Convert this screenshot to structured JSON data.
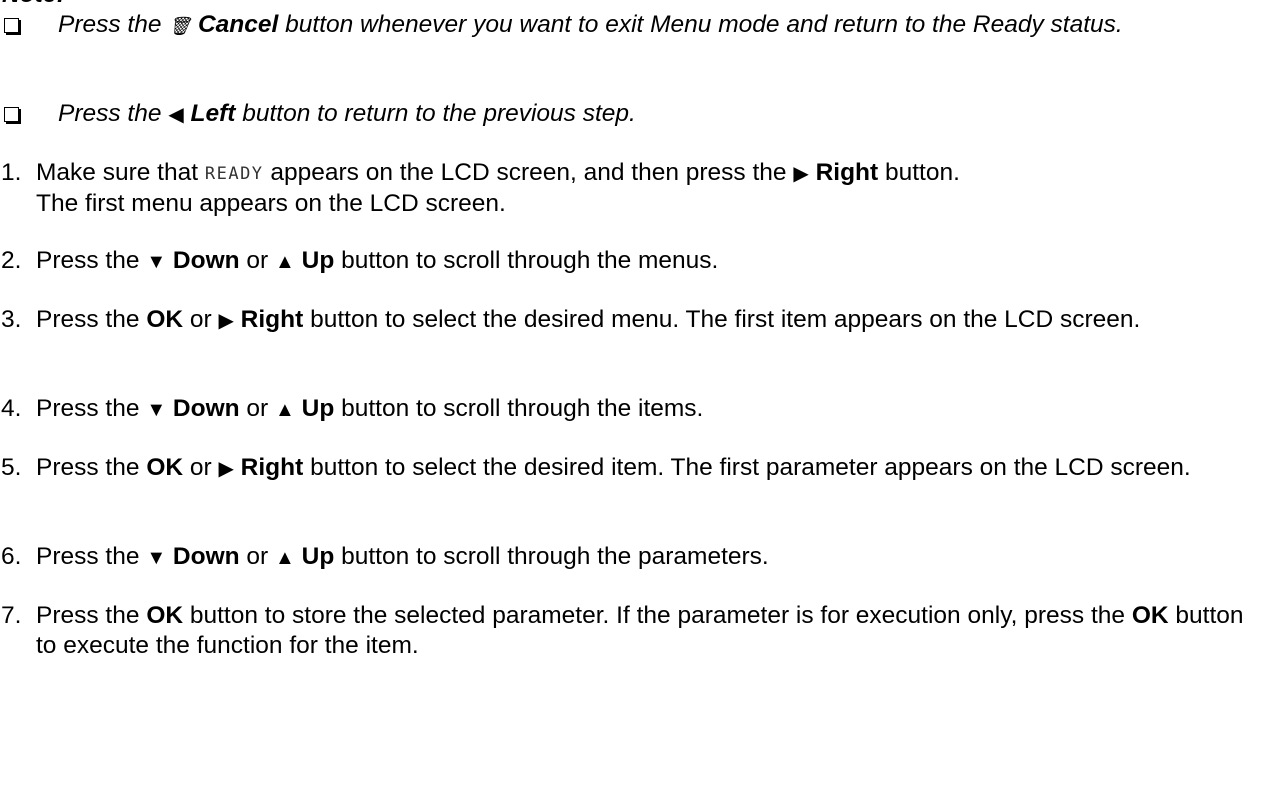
{
  "heading": "Note:",
  "notes": [
    {
      "pre": "Press the ",
      "icon": "trash-cancel-icon",
      "icon_glyph": "🗑",
      "bold": "Cancel",
      "post": " button whenever you want to exit Menu mode and return to the Ready status."
    },
    {
      "pre": "Press the ",
      "icon": "left-triangle-icon",
      "icon_glyph": "◀",
      "bold": "Left",
      "post": " button to return to the previous step."
    }
  ],
  "steps": [
    {
      "num": "1.",
      "line1_a": "Make sure that ",
      "lcd_text": "READY",
      "line1_b": " appears on the LCD screen, and then press the ",
      "right_glyph": "▶",
      "bold": "Right",
      "line1_c": " button.",
      "line2": "The first menu appears on the LCD screen."
    },
    {
      "num": "2.",
      "a": "Press the ",
      "down_glyph": "▼",
      "down": "Down",
      "or": " or ",
      "up_glyph": "▲",
      "up": "Up",
      "b": " button to scroll through the menus."
    },
    {
      "num": "3.",
      "a": "Press the ",
      "ok": "OK",
      "or": " or ",
      "right_glyph": "▶",
      "right": "Right",
      "b": " button to select the desired menu. The first item appears on the LCD screen."
    },
    {
      "num": "4.",
      "a": "Press the ",
      "down_glyph": "▼",
      "down": "Down",
      "or": " or ",
      "up_glyph": "▲",
      "up": "Up",
      "b": " button to scroll through the items."
    },
    {
      "num": "5.",
      "a": "Press the ",
      "ok": "OK",
      "or": " or ",
      "right_glyph": "▶",
      "right": "Right",
      "b": " button to select the desired item. The first parameter appears on the LCD screen."
    },
    {
      "num": "6.",
      "a": "Press the ",
      "down_glyph": "▼",
      "down": "Down",
      "or": " or ",
      "up_glyph": "▲",
      "up": "Up",
      "b": " button to scroll through the parameters."
    },
    {
      "num": "7.",
      "a": "Press the ",
      "ok": "OK",
      "b": " button to store the selected parameter. If the parameter is for execution only, press the ",
      "ok2": "OK",
      "c": " button to execute the function for the item."
    }
  ]
}
